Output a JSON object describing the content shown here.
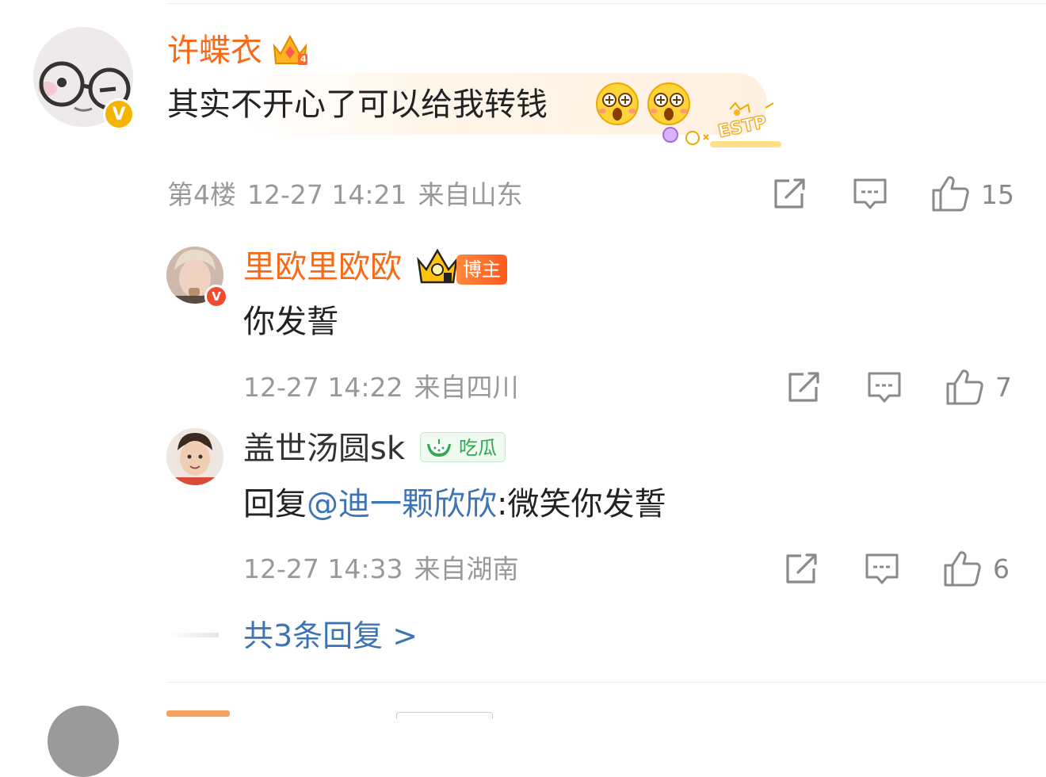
{
  "comment": {
    "username": "许蝶衣",
    "text": "其实不开心了可以给我转钱",
    "floor": "第4楼",
    "time": "12-27 14:21",
    "location": "来自山东",
    "likes": "15",
    "badge_level": "4"
  },
  "replies": [
    {
      "username": "里欧里欧欧",
      "tag": "博主",
      "text": "你发誓",
      "time": "12-27 14:22",
      "location": "来自四川",
      "likes": "7"
    },
    {
      "username": "盖世汤圆sk",
      "tag": "吃瓜",
      "text_prefix": "回复",
      "mention": "@迪一颗欣欣",
      "text_suffix": ":微笑你发誓",
      "time": "12-27 14:33",
      "location": "来自湖南",
      "likes": "6"
    }
  ],
  "more_replies": "共3条回复 >",
  "decor": {
    "estp": "ESTP"
  },
  "colors": {
    "orange": "#f76a1a",
    "link": "#3d74b3",
    "meta": "#999999",
    "green": "#2fa84f"
  }
}
